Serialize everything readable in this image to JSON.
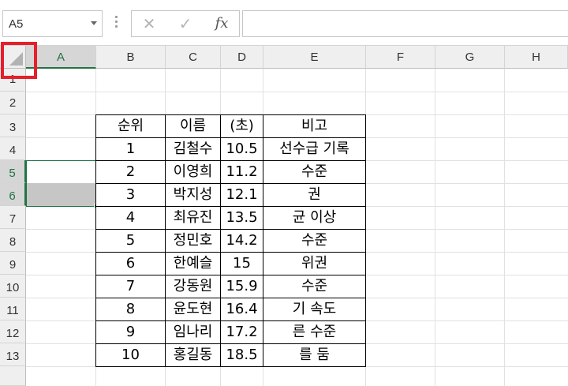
{
  "formula_bar": {
    "name_box": "A5",
    "cancel_symbol": "✕",
    "enter_symbol": "✓",
    "fx_symbol": "fx",
    "formula": ""
  },
  "sheet": {
    "columns": [
      "A",
      "B",
      "C",
      "D",
      "E",
      "F",
      "G",
      "H"
    ],
    "rows": [
      "1",
      "2",
      "3",
      "4",
      "5",
      "6",
      "7",
      "8",
      "9",
      "10",
      "11",
      "12",
      "13"
    ],
    "selected_cell": "A5",
    "selected_range": "A5:A6"
  },
  "table": {
    "headers": [
      "순위",
      "이름",
      "(초)",
      "비고"
    ],
    "rows": [
      [
        "1",
        "김철수",
        "10.5",
        "선수급 기록"
      ],
      [
        "2",
        "이영희",
        "11.2",
        "수준"
      ],
      [
        "3",
        "박지성",
        "12.1",
        "권"
      ],
      [
        "4",
        "최유진",
        "13.5",
        "균 이상"
      ],
      [
        "5",
        "정민호",
        "14.2",
        "수준"
      ],
      [
        "6",
        "한예슬",
        "15",
        "위권"
      ],
      [
        "7",
        "강동원",
        "15.9",
        "수준"
      ],
      [
        "8",
        "윤도현",
        "16.4",
        "기 속도"
      ],
      [
        "9",
        "임나리",
        "17.2",
        "른 수준"
      ],
      [
        "10",
        "홍길동",
        "18.5",
        "를 둠"
      ]
    ]
  },
  "highlight_color": "#e5202a",
  "selection_color": "#217346"
}
